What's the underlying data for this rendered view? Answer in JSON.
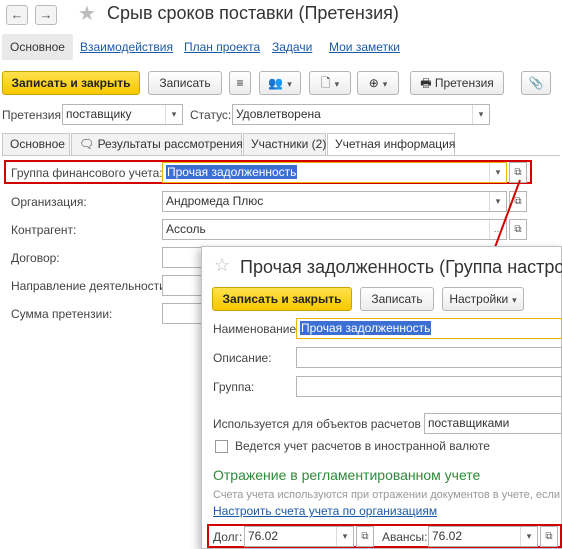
{
  "window": {
    "back_icon": "arrow-left-icon",
    "forward_icon": "arrow-right-icon",
    "title": "Срыв сроков поставки (Претензия)"
  },
  "nav_links": [
    "Основное",
    "Взаимодействия",
    "План проекта",
    "Задачи",
    "Мои заметки"
  ],
  "toolbar": {
    "save_close": "Записать и закрыть",
    "save": "Записать",
    "claim": "Претензия"
  },
  "header": {
    "claim_label": "Претензия:",
    "claim_value": "поставщику",
    "status_label": "Статус:",
    "status_value": "Удовлетворена"
  },
  "tabs": [
    "Основное",
    "Результаты рассмотрения",
    "Участники (2)",
    "Учетная информация"
  ],
  "form": {
    "fin_group_label": "Группа финансового учета:",
    "fin_group_value": "Прочая задолженность",
    "org_label": "Организация:",
    "org_value": "Андромеда Плюс",
    "contractor_label": "Контрагент:",
    "contractor_value": "Ассоль",
    "contract_label": "Договор:",
    "direction_label": "Направление деятельности:",
    "sum_label": "Сумма претензии:"
  },
  "popup": {
    "title": "Прочая задолженность (Группа настроек",
    "save_close": "Записать и закрыть",
    "save": "Записать",
    "settings": "Настройки",
    "name_label": "Наименование:",
    "name_value": "Прочая задолженность",
    "desc_label": "Описание:",
    "group_label": "Группа:",
    "used_for_label": "Используется для объектов расчетов с:",
    "used_for_value": "поставщиками",
    "currency_checkbox": "Ведется учет расчетов в иностранной валюте",
    "section_title": "Отражение в регламентированном учете",
    "section_hint": "Счета учета используются при отражении документов в учете, если",
    "configure_link": "Настроить счета учета по организациям",
    "debt_label": "Долг:",
    "debt_value": "76.02",
    "advance_label": "Авансы:",
    "advance_value": "76.02"
  },
  "colors": {
    "accent_yellow": "#f5c800",
    "highlight_red": "#d40000",
    "link_blue": "#1a5aa8",
    "section_green": "#2e8b3a",
    "selection_blue": "#3b6fd4"
  }
}
